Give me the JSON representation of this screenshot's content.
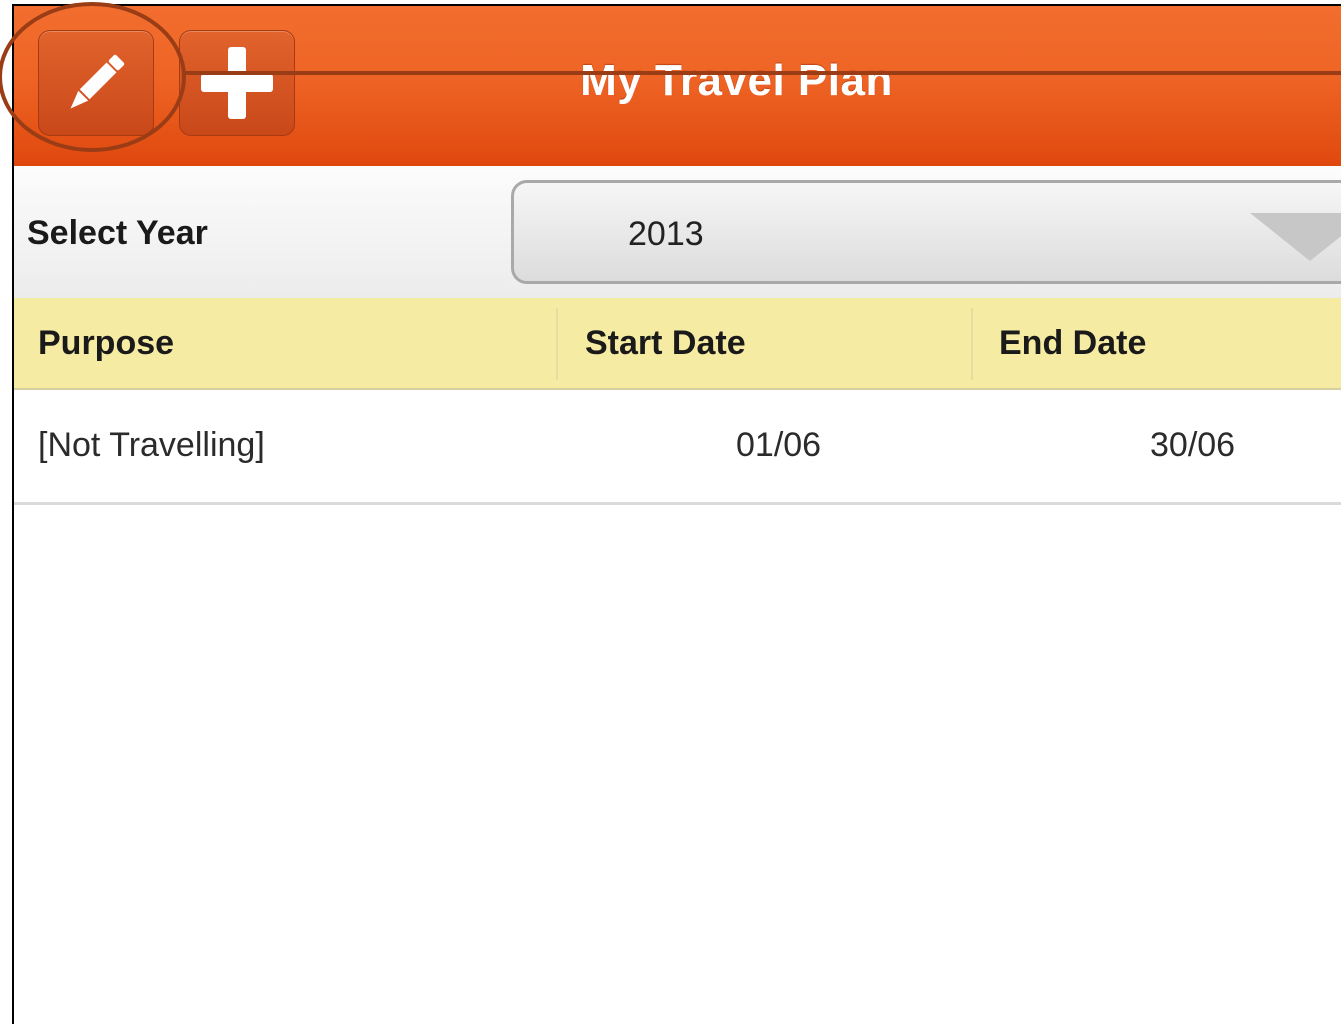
{
  "header": {
    "title": "My Travel Plan",
    "edit_icon": "pencil-icon",
    "add_icon": "plus-icon",
    "background": "#ee6425"
  },
  "year_selector": {
    "label": "Select Year",
    "value": "2013",
    "arrow_icon": "dropdown-arrow-icon"
  },
  "table": {
    "columns": [
      "Purpose",
      "Start Date",
      "End Date"
    ],
    "header_background": "#f5eba2",
    "rows": [
      {
        "purpose": "[Not Travelling]",
        "start": "01/06",
        "end": "30/06"
      }
    ]
  },
  "annotation": {
    "color": "#9a3d16"
  }
}
